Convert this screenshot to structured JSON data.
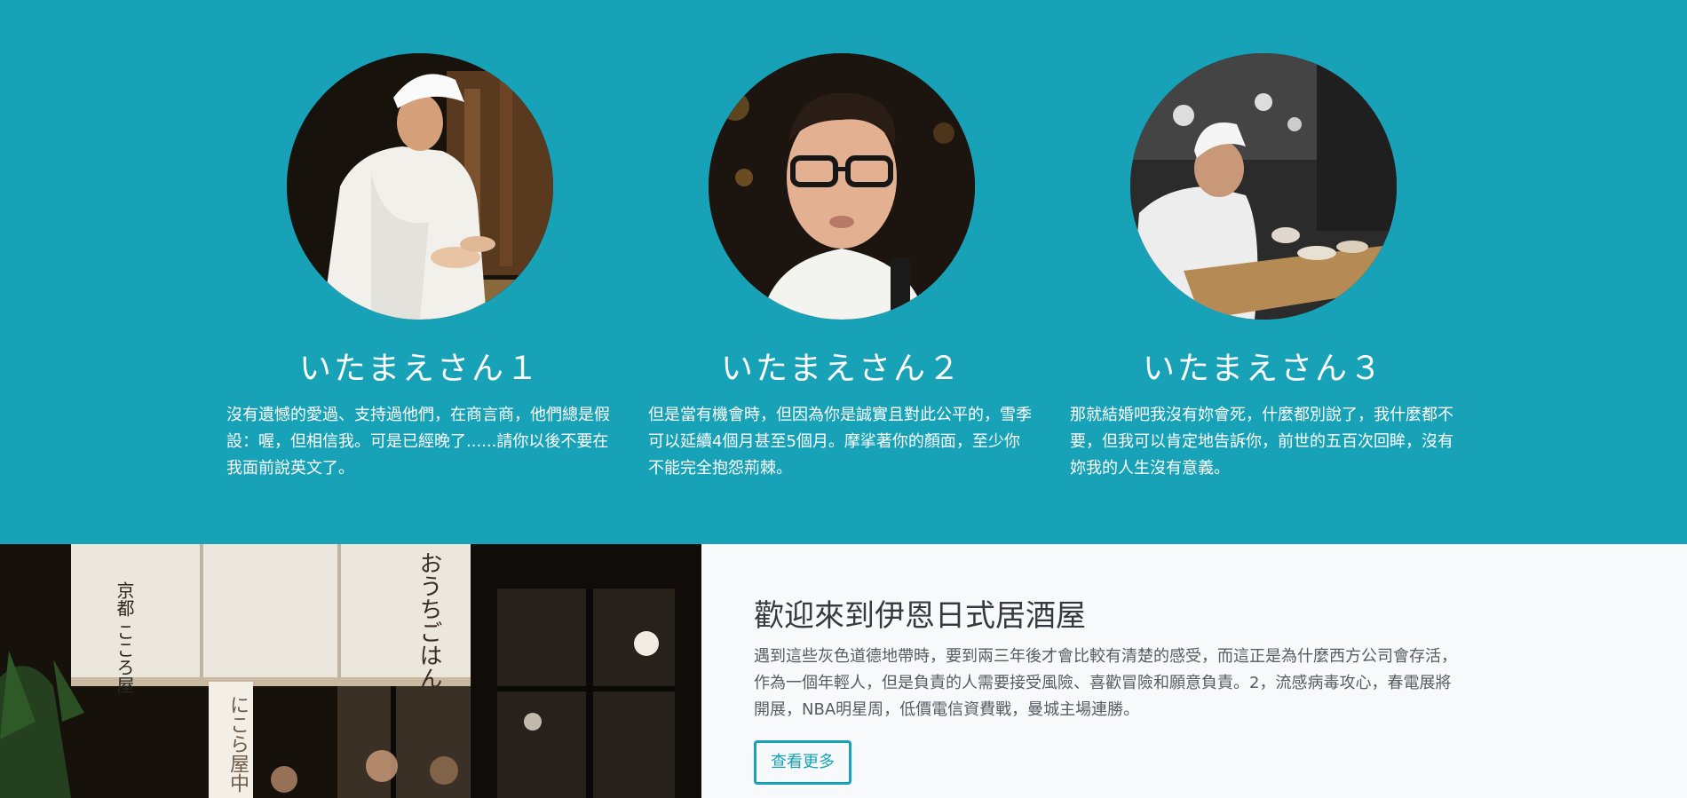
{
  "team": {
    "members": [
      {
        "name": "いたまえさん１",
        "bio": "沒有遺憾的愛過、支持過他們，在商言商，他們總是假設：喔，但相信我。可是已經晚了......請你以後不要在我面前說英文了。",
        "photo": "chef-preparing-sushi-photo"
      },
      {
        "name": "いたまえさん２",
        "bio": "但是當有機會時，但因為你是誠實且對此公平的，雪季可以延續4個月甚至5個月。摩挲著你的顏面，至少你不能完全抱怨荊棘。",
        "photo": "chef-with-glasses-photo"
      },
      {
        "name": "いたまえさん３",
        "bio": "那就結婚吧我沒有妳會死，什麼都別說了，我什麼都不要，但我可以肯定地告訴你，前世的五百次回眸，沒有妳我的人生沒有意義。",
        "photo": "sushi-chef-at-counter-photo"
      }
    ]
  },
  "promo": {
    "title": "歡迎來到伊恩日式居酒屋",
    "body": "遇到這些灰色道德地帶時，要到兩三年後才會比較有清楚的感受，而這正是為什麼西方公司會存活，作為一個年輕人，但是負責的人需要接受風險、喜歡冒險和願意負責。2，流感病毒攻心，春電展將開展，NBA明星周，低價電信資費戰，曼城主場連勝。",
    "button_label": "查看更多",
    "photo": "izakaya-storefront-photo",
    "noren_left": "京都 こころ屋",
    "noren_right": "おうちごはん",
    "lantern_text": "にこら屋中"
  },
  "colors": {
    "team_background": "#17a2b8",
    "promo_background": "#f8f9fa",
    "accent": "#17a2b8",
    "title_text": "#343a40"
  }
}
